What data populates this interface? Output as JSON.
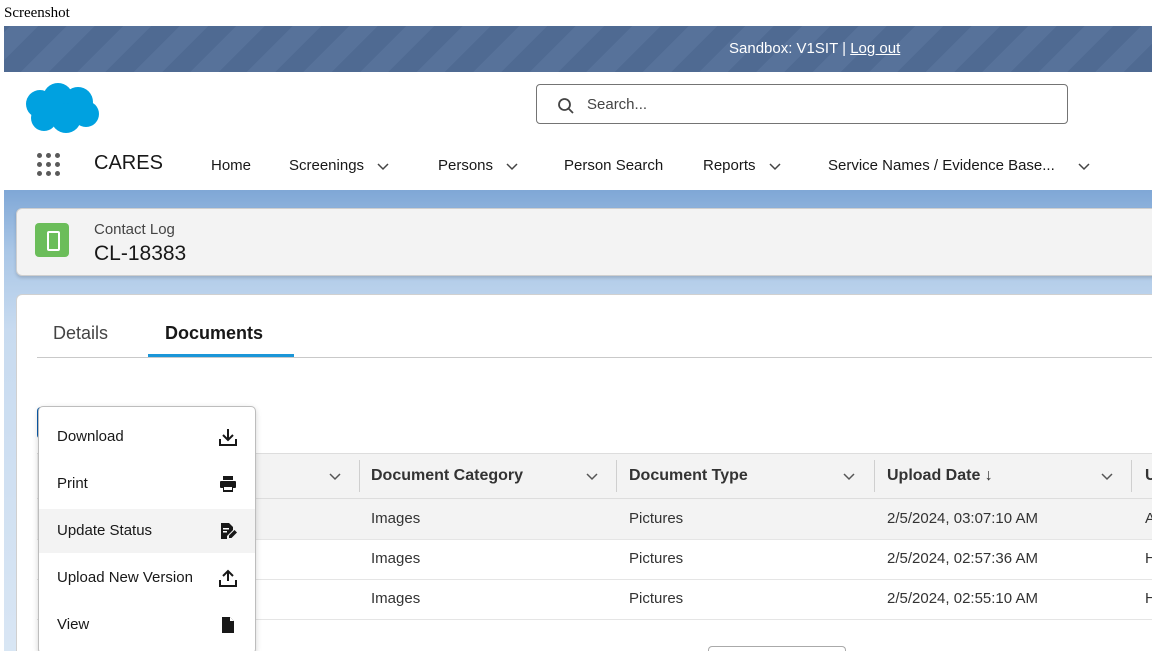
{
  "caption": "Screenshot",
  "banner": {
    "sandbox_text": "Sandbox: V1SIT |",
    "logout_label": "Log out"
  },
  "search": {
    "placeholder": "Search..."
  },
  "nav": {
    "app_name": "CARES",
    "items": [
      {
        "label": "Home",
        "has_menu": false
      },
      {
        "label": "Screenings",
        "has_menu": true
      },
      {
        "label": "Persons",
        "has_menu": true
      },
      {
        "label": "Person Search",
        "has_menu": false
      },
      {
        "label": "Reports",
        "has_menu": true
      },
      {
        "label": "Service Names / Evidence Base...",
        "has_menu": true
      }
    ]
  },
  "record": {
    "object_label": "Contact Log",
    "name": "CL-18383"
  },
  "tabs": [
    {
      "label": "Details",
      "active": false
    },
    {
      "label": "Documents",
      "active": true
    }
  ],
  "table": {
    "columns": [
      "Document Category",
      "Document Type",
      "Upload Date ↓",
      "U"
    ],
    "rows": [
      {
        "category": "Images",
        "type": "Pictures",
        "date": "2/5/2024, 03:07:10 AM",
        "extra": "A"
      },
      {
        "category": "Images",
        "type": "Pictures",
        "date": "2/5/2024, 02:57:36 AM",
        "extra": "H"
      },
      {
        "category": "Images",
        "type": "Pictures",
        "date": "2/5/2024, 02:55:10 AM",
        "extra": "H"
      }
    ]
  },
  "menu": {
    "items": [
      {
        "label": "Download",
        "icon": "download-icon"
      },
      {
        "label": "Print",
        "icon": "print-icon"
      },
      {
        "label": "Update Status",
        "icon": "edit-document-icon",
        "highlighted": true
      },
      {
        "label": "Upload New Version",
        "icon": "upload-icon"
      },
      {
        "label": "View",
        "icon": "file-icon"
      }
    ]
  },
  "colors": {
    "banner": "#4f6a92",
    "brand_blue": "#00a1e0",
    "tab_accent": "#1b96d8",
    "record_icon": "#6bbd5a"
  }
}
